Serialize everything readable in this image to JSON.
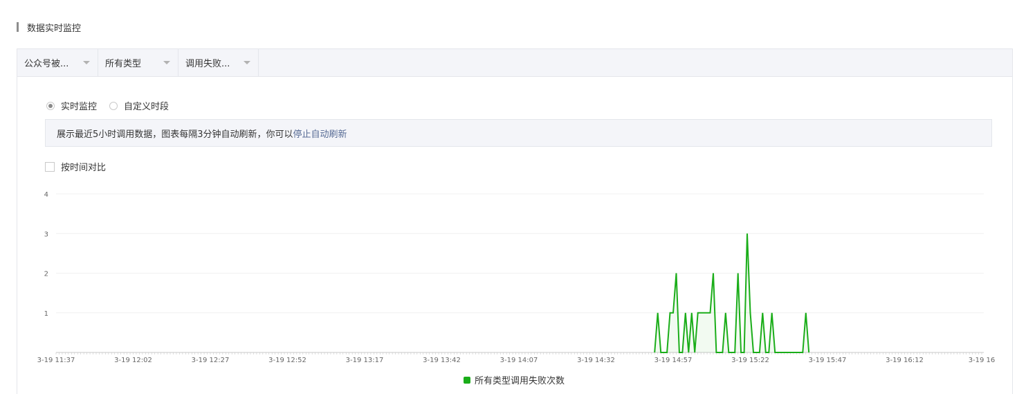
{
  "section": {
    "title": "数据实时监控"
  },
  "filters": [
    {
      "label": "公众号被..."
    },
    {
      "label": "所有类型"
    },
    {
      "label": "调用失败..."
    }
  ],
  "mode": {
    "options": [
      {
        "label": "实时监控",
        "checked": true
      },
      {
        "label": "自定义时段",
        "checked": false
      }
    ]
  },
  "notice": {
    "text": "展示最近5小时调用数据，图表每隔3分钟自动刷新，你可以",
    "link": "停止自动刷新"
  },
  "compare": {
    "label": "按时间对比",
    "checked": false
  },
  "colors": {
    "series": "#1aad19",
    "link": "#576b95",
    "grid": "#f0f0f0"
  },
  "chart_data": {
    "type": "line",
    "xlabel": "",
    "ylabel": "",
    "ylim": [
      0,
      4
    ],
    "y_ticks": [
      "4",
      "3",
      "2",
      "1"
    ],
    "x_tick_labels": [
      "3-19 11:37",
      "3-19 12:02",
      "3-19 12:27",
      "3-19 12:52",
      "3-19 13:17",
      "3-19 13:42",
      "3-19 14:07",
      "3-19 14:32",
      "3-19 14:57",
      "3-19 15:22",
      "3-19 15:47",
      "3-19 16:12",
      "3-19 16"
    ],
    "x_start": "3-19 11:37",
    "x_interval_minutes": 1,
    "grid": true,
    "legend": "bottom-center",
    "series": [
      {
        "name": "所有类型调用失败次数",
        "points": [
          [
            "3-19 14:51",
            0
          ],
          [
            "3-19 14:52",
            1
          ],
          [
            "3-19 14:53",
            0
          ],
          [
            "3-19 14:55",
            0
          ],
          [
            "3-19 14:56",
            1
          ],
          [
            "3-19 14:57",
            1
          ],
          [
            "3-19 14:58",
            2
          ],
          [
            "3-19 14:59",
            0
          ],
          [
            "3-19 15:00",
            0
          ],
          [
            "3-19 15:01",
            1
          ],
          [
            "3-19 15:02",
            0
          ],
          [
            "3-19 15:03",
            1
          ],
          [
            "3-19 15:04",
            0
          ],
          [
            "3-19 15:05",
            1
          ],
          [
            "3-19 15:06",
            1
          ],
          [
            "3-19 15:07",
            1
          ],
          [
            "3-19 15:08",
            1
          ],
          [
            "3-19 15:09",
            1
          ],
          [
            "3-19 15:10",
            2
          ],
          [
            "3-19 15:11",
            0
          ],
          [
            "3-19 15:13",
            0
          ],
          [
            "3-19 15:14",
            1
          ],
          [
            "3-19 15:15",
            0
          ],
          [
            "3-19 15:17",
            0
          ],
          [
            "3-19 15:18",
            2
          ],
          [
            "3-19 15:19",
            0
          ],
          [
            "3-19 15:20",
            0
          ],
          [
            "3-19 15:21",
            3
          ],
          [
            "3-19 15:22",
            1
          ],
          [
            "3-19 15:23",
            0
          ],
          [
            "3-19 15:25",
            0
          ],
          [
            "3-19 15:26",
            1
          ],
          [
            "3-19 15:27",
            0
          ],
          [
            "3-19 15:28",
            0
          ],
          [
            "3-19 15:29",
            1
          ],
          [
            "3-19 15:30",
            0
          ],
          [
            "3-19 15:39",
            0
          ],
          [
            "3-19 15:40",
            1
          ],
          [
            "3-19 15:41",
            0
          ]
        ]
      }
    ]
  }
}
